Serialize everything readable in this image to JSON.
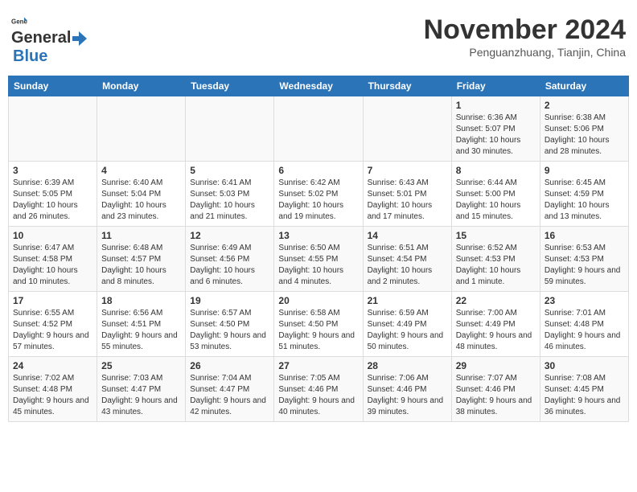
{
  "header": {
    "logo_general": "General",
    "logo_blue": "Blue",
    "month_title": "November 2024",
    "location": "Penguanzhuang, Tianjin, China"
  },
  "days_of_week": [
    "Sunday",
    "Monday",
    "Tuesday",
    "Wednesday",
    "Thursday",
    "Friday",
    "Saturday"
  ],
  "weeks": [
    [
      {
        "day": "",
        "info": ""
      },
      {
        "day": "",
        "info": ""
      },
      {
        "day": "",
        "info": ""
      },
      {
        "day": "",
        "info": ""
      },
      {
        "day": "",
        "info": ""
      },
      {
        "day": "1",
        "info": "Sunrise: 6:36 AM\nSunset: 5:07 PM\nDaylight: 10 hours and 30 minutes."
      },
      {
        "day": "2",
        "info": "Sunrise: 6:38 AM\nSunset: 5:06 PM\nDaylight: 10 hours and 28 minutes."
      }
    ],
    [
      {
        "day": "3",
        "info": "Sunrise: 6:39 AM\nSunset: 5:05 PM\nDaylight: 10 hours and 26 minutes."
      },
      {
        "day": "4",
        "info": "Sunrise: 6:40 AM\nSunset: 5:04 PM\nDaylight: 10 hours and 23 minutes."
      },
      {
        "day": "5",
        "info": "Sunrise: 6:41 AM\nSunset: 5:03 PM\nDaylight: 10 hours and 21 minutes."
      },
      {
        "day": "6",
        "info": "Sunrise: 6:42 AM\nSunset: 5:02 PM\nDaylight: 10 hours and 19 minutes."
      },
      {
        "day": "7",
        "info": "Sunrise: 6:43 AM\nSunset: 5:01 PM\nDaylight: 10 hours and 17 minutes."
      },
      {
        "day": "8",
        "info": "Sunrise: 6:44 AM\nSunset: 5:00 PM\nDaylight: 10 hours and 15 minutes."
      },
      {
        "day": "9",
        "info": "Sunrise: 6:45 AM\nSunset: 4:59 PM\nDaylight: 10 hours and 13 minutes."
      }
    ],
    [
      {
        "day": "10",
        "info": "Sunrise: 6:47 AM\nSunset: 4:58 PM\nDaylight: 10 hours and 10 minutes."
      },
      {
        "day": "11",
        "info": "Sunrise: 6:48 AM\nSunset: 4:57 PM\nDaylight: 10 hours and 8 minutes."
      },
      {
        "day": "12",
        "info": "Sunrise: 6:49 AM\nSunset: 4:56 PM\nDaylight: 10 hours and 6 minutes."
      },
      {
        "day": "13",
        "info": "Sunrise: 6:50 AM\nSunset: 4:55 PM\nDaylight: 10 hours and 4 minutes."
      },
      {
        "day": "14",
        "info": "Sunrise: 6:51 AM\nSunset: 4:54 PM\nDaylight: 10 hours and 2 minutes."
      },
      {
        "day": "15",
        "info": "Sunrise: 6:52 AM\nSunset: 4:53 PM\nDaylight: 10 hours and 1 minute."
      },
      {
        "day": "16",
        "info": "Sunrise: 6:53 AM\nSunset: 4:53 PM\nDaylight: 9 hours and 59 minutes."
      }
    ],
    [
      {
        "day": "17",
        "info": "Sunrise: 6:55 AM\nSunset: 4:52 PM\nDaylight: 9 hours and 57 minutes."
      },
      {
        "day": "18",
        "info": "Sunrise: 6:56 AM\nSunset: 4:51 PM\nDaylight: 9 hours and 55 minutes."
      },
      {
        "day": "19",
        "info": "Sunrise: 6:57 AM\nSunset: 4:50 PM\nDaylight: 9 hours and 53 minutes."
      },
      {
        "day": "20",
        "info": "Sunrise: 6:58 AM\nSunset: 4:50 PM\nDaylight: 9 hours and 51 minutes."
      },
      {
        "day": "21",
        "info": "Sunrise: 6:59 AM\nSunset: 4:49 PM\nDaylight: 9 hours and 50 minutes."
      },
      {
        "day": "22",
        "info": "Sunrise: 7:00 AM\nSunset: 4:49 PM\nDaylight: 9 hours and 48 minutes."
      },
      {
        "day": "23",
        "info": "Sunrise: 7:01 AM\nSunset: 4:48 PM\nDaylight: 9 hours and 46 minutes."
      }
    ],
    [
      {
        "day": "24",
        "info": "Sunrise: 7:02 AM\nSunset: 4:48 PM\nDaylight: 9 hours and 45 minutes."
      },
      {
        "day": "25",
        "info": "Sunrise: 7:03 AM\nSunset: 4:47 PM\nDaylight: 9 hours and 43 minutes."
      },
      {
        "day": "26",
        "info": "Sunrise: 7:04 AM\nSunset: 4:47 PM\nDaylight: 9 hours and 42 minutes."
      },
      {
        "day": "27",
        "info": "Sunrise: 7:05 AM\nSunset: 4:46 PM\nDaylight: 9 hours and 40 minutes."
      },
      {
        "day": "28",
        "info": "Sunrise: 7:06 AM\nSunset: 4:46 PM\nDaylight: 9 hours and 39 minutes."
      },
      {
        "day": "29",
        "info": "Sunrise: 7:07 AM\nSunset: 4:46 PM\nDaylight: 9 hours and 38 minutes."
      },
      {
        "day": "30",
        "info": "Sunrise: 7:08 AM\nSunset: 4:45 PM\nDaylight: 9 hours and 36 minutes."
      }
    ]
  ]
}
